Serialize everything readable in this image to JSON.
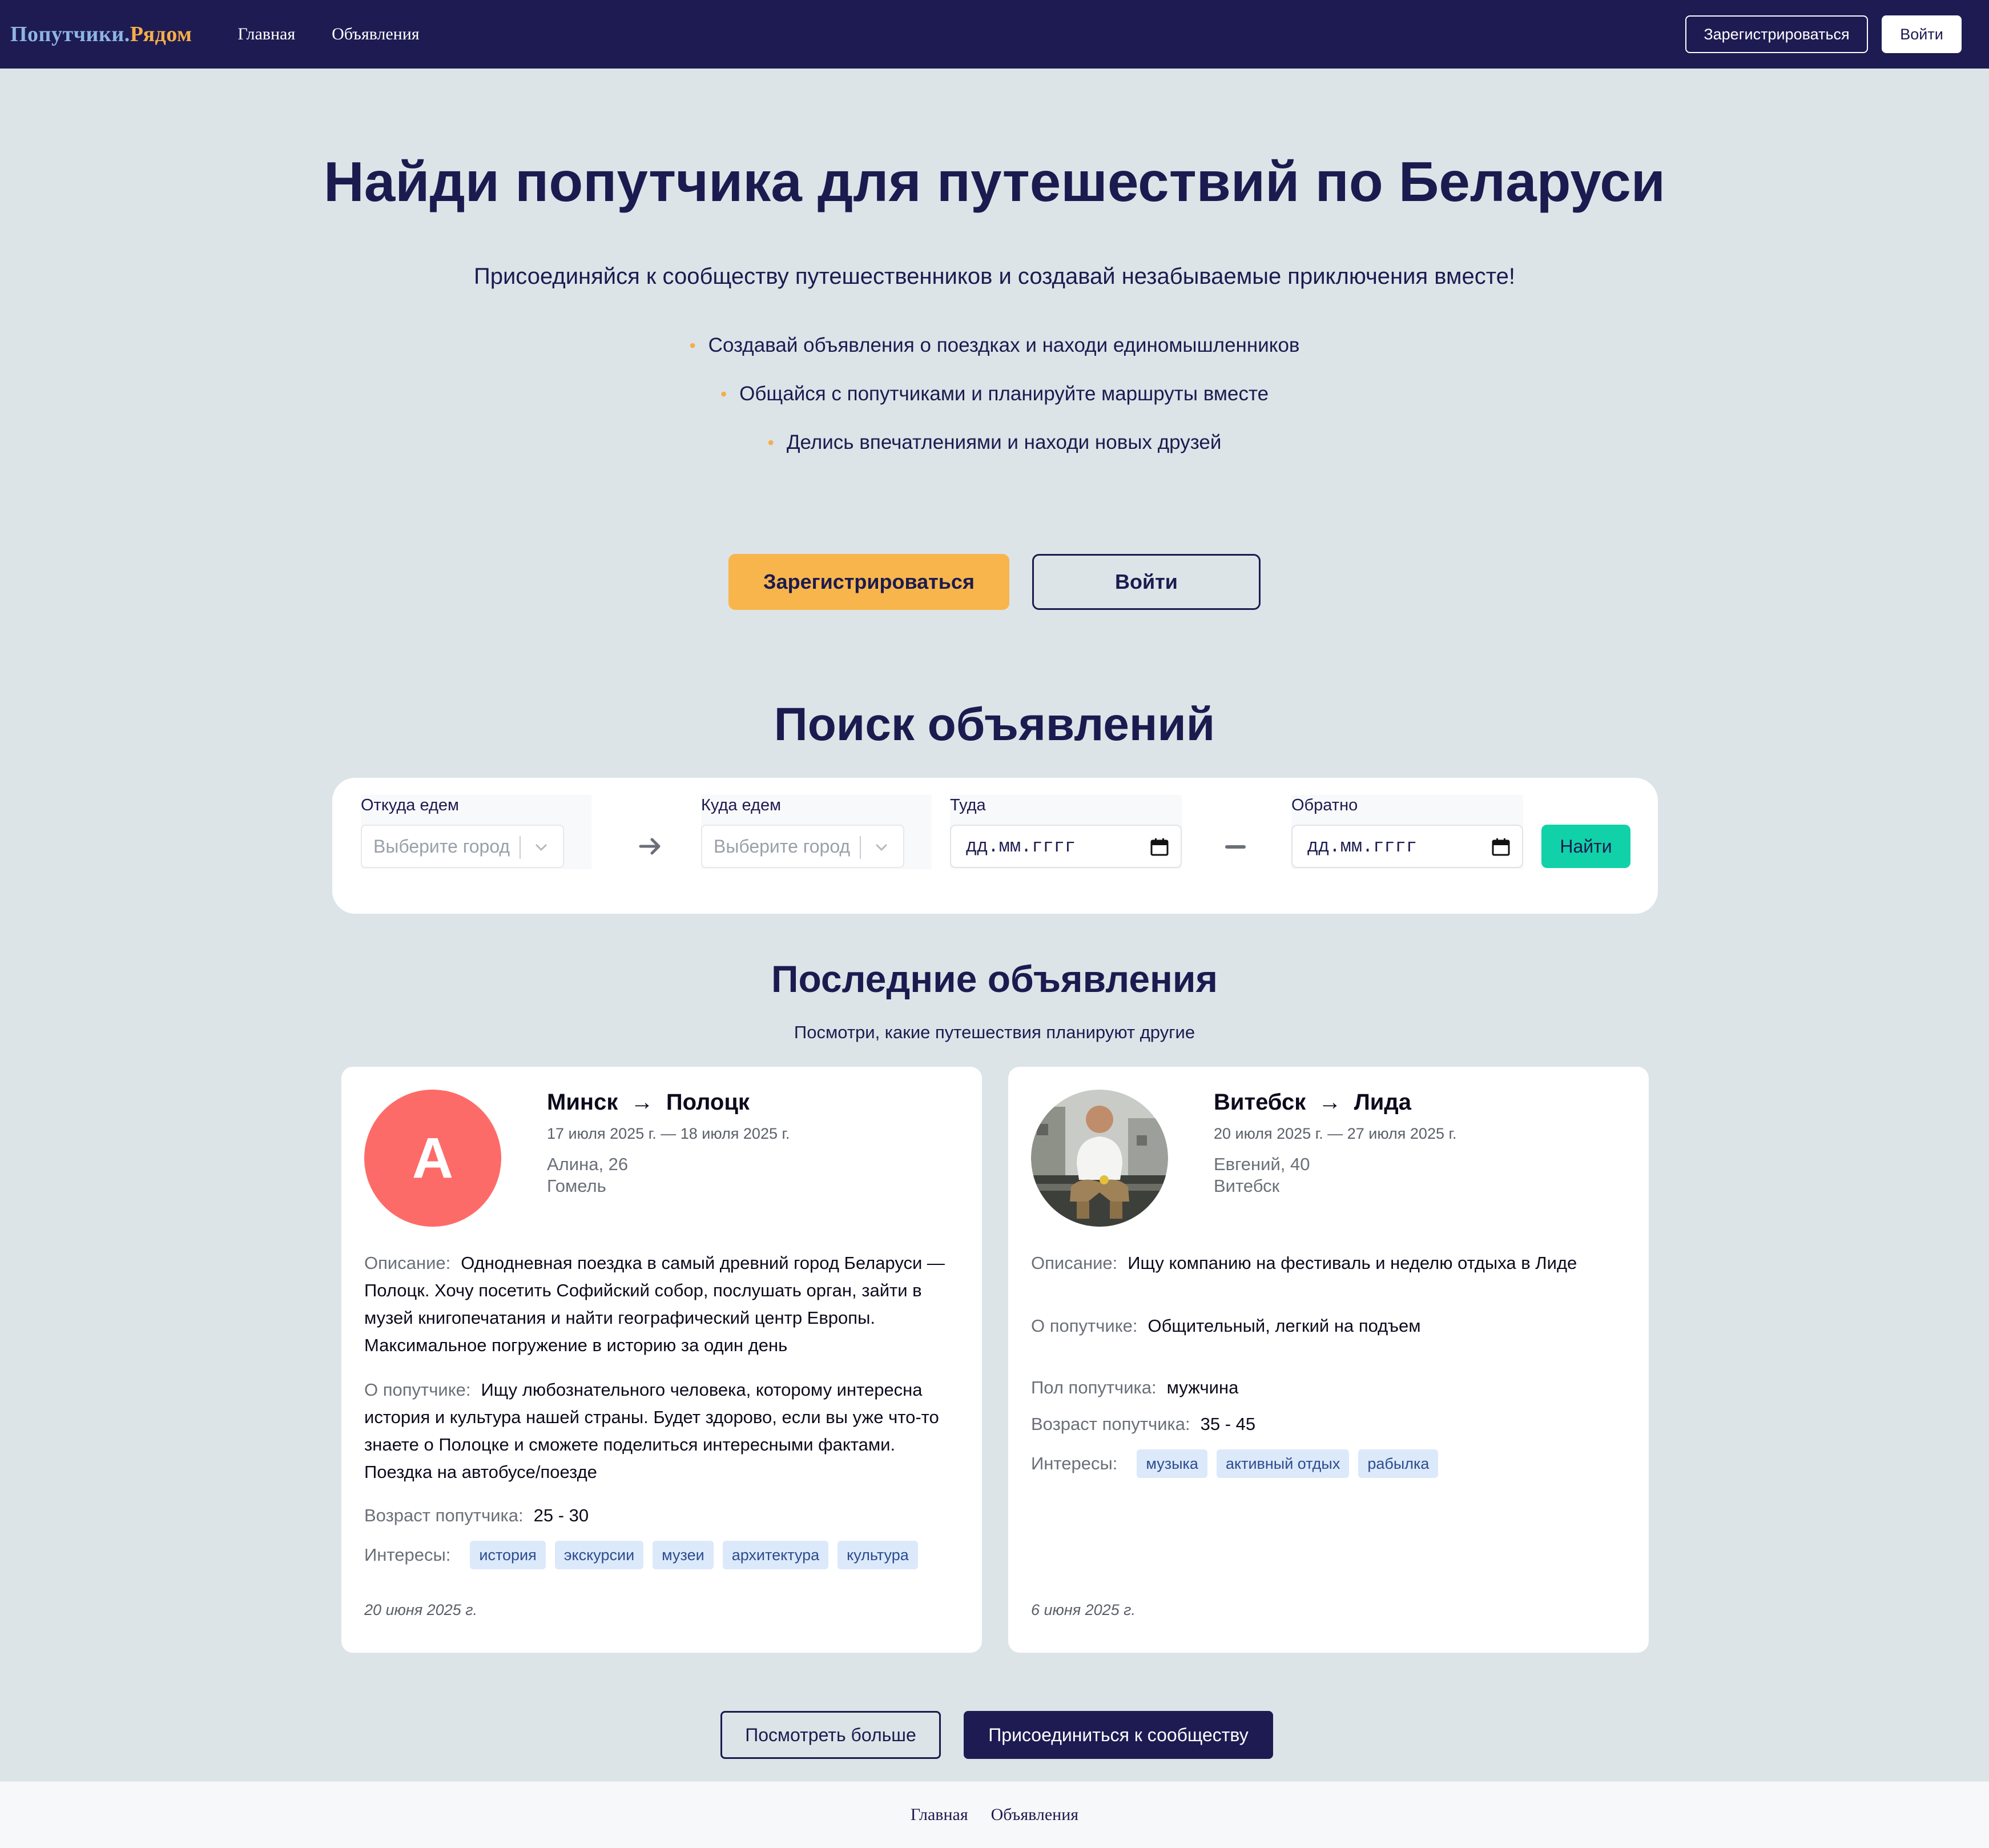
{
  "header": {
    "brand_part1": "Попутчики.",
    "brand_part2": "Рядом",
    "nav": [
      "Главная",
      "Объявления"
    ],
    "register_label": "Зарегистрироваться",
    "login_label": "Войти"
  },
  "hero": {
    "title": "Найди попутчика для путешествий по Беларуси",
    "subtitle": "Присоединяйся к сообществу путешественников и создавай незабываемые приключения вместе!",
    "features": [
      "Создавай объявления о поездках и находи единомышленников",
      "Общайся с попутчиками и планируйте маршруты вместе",
      "Делись впечатлениями и находи новых друзей"
    ],
    "bullet": "•",
    "register_label": "Зарегистрироваться",
    "login_label": "Войти"
  },
  "search": {
    "title": "Поиск объявлений",
    "from_label": "Откуда едем",
    "from_placeholder": "Выберите город",
    "to_label": "Куда едем",
    "to_placeholder": "Выберите город",
    "depart_label": "Туда",
    "depart_value": "дд.мм.гггг",
    "return_label": "Обратно",
    "return_value": "дд.мм.гггг",
    "find_label": "Найти"
  },
  "latest": {
    "title": "Последние объявления",
    "subtitle": "Посмотри, какие путешествия планируют другие",
    "cards": [
      {
        "avatar_letter": "А",
        "from": "Минск",
        "arrow": "→",
        "to": "Полоцк",
        "dates": "17 июля 2025 г. — 18 июля 2025 г.",
        "name_age": "Алина, 26",
        "city": "Гомель",
        "description_label": "Описание:",
        "description": "Однодневная поездка в самый древний город Беларуси — Полоцк. Хочу посетить Софийский собор, послушать орган, зайти в музей книгопечатания и найти географический центр Европы. Максимальное погружение в историю за один день",
        "about_label": "О попутчике:",
        "about": "Ищу любознательного человека, которому интересна история и культура нашей страны. Будет здорово, если вы уже что-то знаете о Полоцке и сможете поделиться интересными фактами. Поездка на автобусе/поезде",
        "age_label": "Возраст попутчика:",
        "age": "25 - 30",
        "interests_label": "Интересы:",
        "interests": [
          "история",
          "экскурсии",
          "музеи",
          "архитектура",
          "культура"
        ],
        "posted": "20 июня 2025 г."
      },
      {
        "from": "Витебск",
        "arrow": "→",
        "to": "Лида",
        "dates": "20 июля 2025 г. — 27 июля 2025 г.",
        "name_age": "Евгений, 40",
        "city": "Витебск",
        "description_label": "Описание:",
        "description": "Ищу компанию на фестиваль и неделю отдыха в Лиде",
        "about_label": "О попутчике:",
        "about": "Общительный, легкий на подъем",
        "gender_label": "Пол попутчика:",
        "gender": "мужчина",
        "age_label": "Возраст попутчика:",
        "age": "35 - 45",
        "interests_label": "Интересы:",
        "interests": [
          "музыка",
          "активный отдых",
          "рабылка"
        ],
        "posted": "6 июня 2025 г."
      }
    ],
    "more_label": "Посмотреть больше",
    "join_label": "Присоединиться к сообществу"
  },
  "footer": {
    "links": [
      "Главная",
      "Объявления"
    ]
  },
  "colors": {
    "navy": "#1d1b52",
    "accent_orange": "#f8b54c",
    "accent_teal": "#10d1a8",
    "avatar_red": "#fd6b68",
    "tag_bg": "#dce9fb",
    "page_bg": "#dce4e8"
  }
}
